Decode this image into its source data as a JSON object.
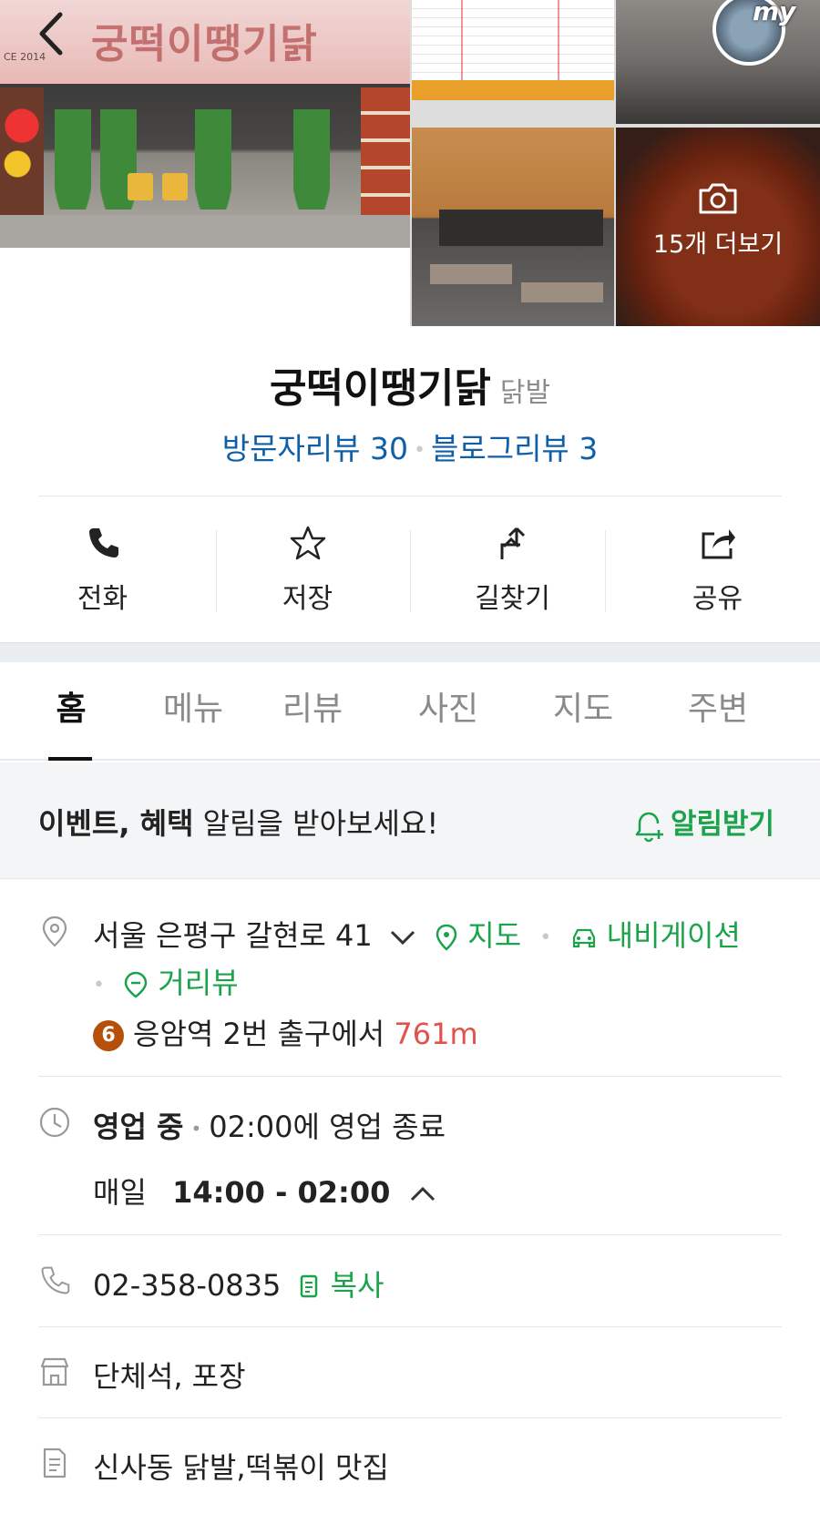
{
  "header": {
    "back_label": "back",
    "my_label": "my",
    "sign_text": "궁떡이땡기닭",
    "sign_since": "CE 2014",
    "photos_more_label": "15개 더보기"
  },
  "place": {
    "name": "궁떡이땡기닭",
    "category": "닭발",
    "visitor_reviews": "방문자리뷰 30",
    "blog_reviews": "블로그리뷰 3"
  },
  "actions": [
    {
      "label": "전화",
      "icon": "phone-icon"
    },
    {
      "label": "저장",
      "icon": "star-icon"
    },
    {
      "label": "길찾기",
      "icon": "directions-icon"
    },
    {
      "label": "공유",
      "icon": "share-icon"
    }
  ],
  "tabs": [
    {
      "label": "홈",
      "active": true
    },
    {
      "label": "메뉴"
    },
    {
      "label": "리뷰"
    },
    {
      "label": "사진"
    },
    {
      "label": "지도"
    },
    {
      "label": "주변"
    }
  ],
  "notice": {
    "bold_text": "이벤트, 혜택",
    "text": " 알림을 받아보세요!",
    "button_label": "알림받기"
  },
  "address": {
    "text": "서울 은평구 갈현로 41",
    "map_link": "지도",
    "navigation_link": "내비게이션",
    "streetview_link": "거리뷰",
    "subway_line": "6",
    "station": "응암역",
    "exit_text": " 2번 출구에서 ",
    "distance": "761m"
  },
  "hours": {
    "status": "영업 중",
    "closing": "02:00에 영업 종료",
    "days": "매일",
    "time_range": "14:00 - 02:00"
  },
  "phone": {
    "number": "02-358-0835",
    "copy_label": "복사"
  },
  "amenities": {
    "text": "단체석, 포장"
  },
  "description": {
    "text": "신사동 닭발,떡볶이 맛집"
  },
  "colors": {
    "accent_green": "#1aa34a",
    "review_blue": "#0f5fa8",
    "distance_red": "#e0524a",
    "subway_line6": "#b5500b"
  }
}
